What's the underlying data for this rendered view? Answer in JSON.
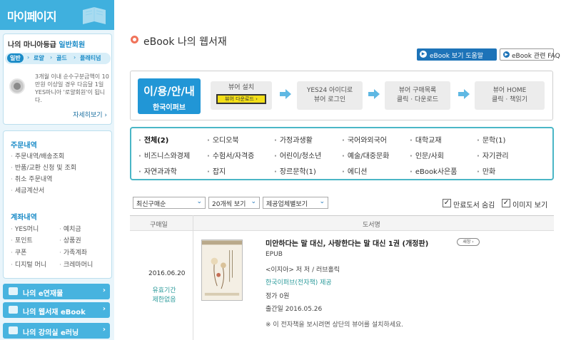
{
  "sidebar": {
    "title": "마이페이지",
    "grade": {
      "prefix": "나의 마니아등급",
      "value": "일반회원",
      "tabs": [
        "일반",
        "로얄",
        "골드",
        "플래티넘"
      ],
      "desc": "3개월 이내 순수구분금액이 10만원 이상일 경우 다음달 1일 YES마니아 '로얄회원'이 됩니다.",
      "more": "자세히보기 ›"
    },
    "order_section": {
      "title": "주문내역",
      "items": [
        "주문내역/배송조회",
        "반품/교환 신청 및 조회",
        "취소 주문내역",
        "세금계산서"
      ]
    },
    "account_section": {
      "title": "계좌내역",
      "items": [
        "YES머니",
        "예치금",
        "포인트",
        "상품권",
        "쿠폰",
        "가족계좌",
        "디지털 머니",
        "크레마머니"
      ]
    },
    "buttons": [
      "나의 e연재물",
      "나의 웹서재 eBook",
      "나의 강의실 e러닝"
    ]
  },
  "header": {
    "title": "eBook 나의 웹서재",
    "help_label": "eBook 보기 도움말",
    "faq_label": "eBook 관련 FAQ"
  },
  "guide": {
    "title": "이/용/안/내",
    "subtitle": "한국이퍼브",
    "step1": {
      "line1": "뷰어 설치",
      "button": "뷰어 다운로드 ›"
    },
    "step2": {
      "line1": "YES24 아이디로",
      "line2": "뷰어 로그인"
    },
    "step3": {
      "line1": "뷰어 구매목록",
      "line2": "클릭 · 다운로드"
    },
    "step4": {
      "line1": "뷰어 HOME",
      "line2": "클릭 · 책읽기"
    }
  },
  "categories": [
    "전체(2)",
    "오디오북",
    "가정과생활",
    "국어와외국어",
    "대학교재",
    "문학(1)",
    "비즈니스와경제",
    "수험서/자격증",
    "어린이/청소년",
    "예술/대중문화",
    "인문/사회",
    "자기관리",
    "자연과과학",
    "잡지",
    "장르문학(1)",
    "에디션",
    "eBook사은품",
    "만화"
  ],
  "filters": {
    "sort": "최신구매순",
    "per_page": "20개씩 보기",
    "publisher": "제공업체별보기",
    "hide_expired": "만료도서 숨김",
    "show_image": "이미지 보기"
  },
  "table": {
    "col_date": "구매일",
    "col_book": "도서명",
    "rows": [
      {
        "date": "2016.06.20",
        "expiry_1": "유효기간",
        "expiry_2": "제한없음",
        "title": "미안하다는 말 대신, 사랑한다는 말 대신 1권 (개정판)",
        "badge": "새창 ›",
        "format": "EPUB",
        "author": "<이지아> 저 저 / 러브홀릭",
        "publisher": "한국이퍼브(전자책) 제공",
        "price": "정가 0원",
        "release": "출간일 2016.05.26",
        "notice": "※ 이 전자책을 보시려면 상단의 뷰어를 설치하세요."
      }
    ]
  },
  "colors": {
    "accent": "#3fb0de",
    "primary": "#2196d6",
    "category_border": "#4ab6c6",
    "highlight": "#f3df17"
  }
}
